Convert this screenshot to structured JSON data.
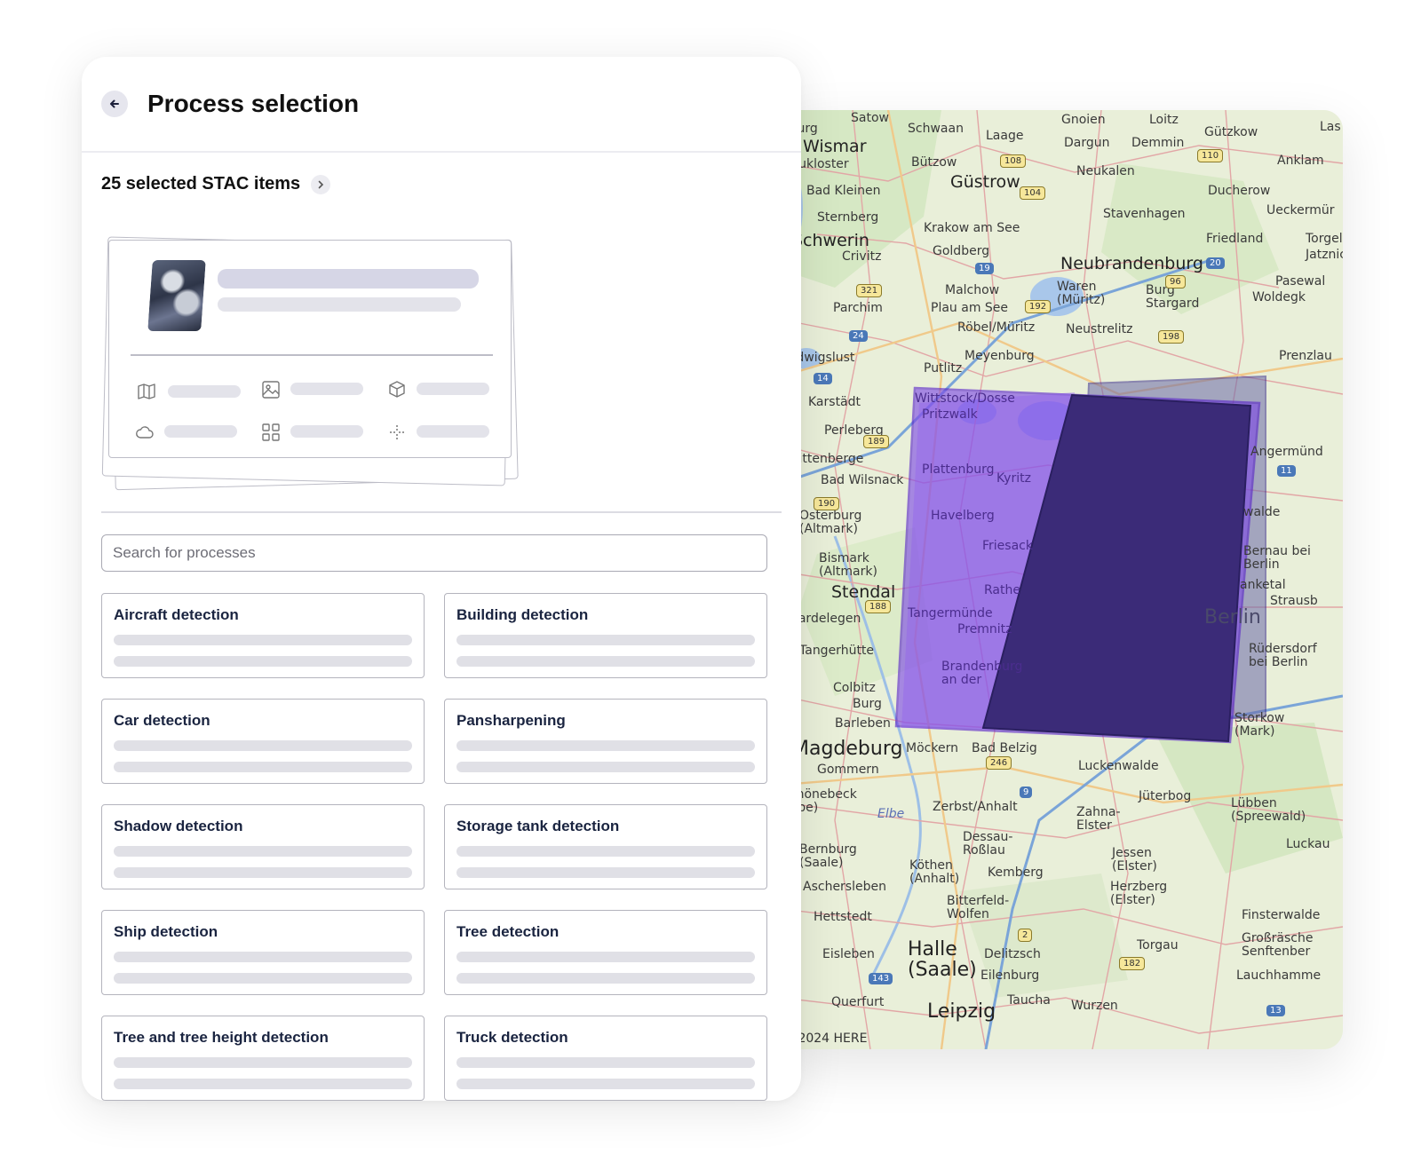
{
  "header": {
    "title": "Process selection"
  },
  "stac": {
    "label": "25 selected STAC items"
  },
  "search": {
    "placeholder": "Search for processes"
  },
  "processes": [
    "Aircraft detection",
    "Building detection",
    "Car detection",
    "Pansharpening",
    "Shadow detection",
    "Storage tank detection",
    "Ship detection",
    "Tree detection",
    "Tree and tree height detection",
    "Truck detection"
  ],
  "map": {
    "copyright": "© 2024 HERE",
    "towns": [
      "Satow",
      "eburg",
      "Wismar",
      "Schwaan",
      "Laage",
      "Gnoien",
      "Loitz",
      "Gützkow",
      "Las",
      "Dargun",
      "Demmin",
      "Anklam",
      "Neukloster",
      "Bützow",
      "Neukalen",
      "Güstrow",
      "Ducherow",
      "Bad Kleinen",
      "Ueckermür",
      "Sternberg",
      "Stavenhagen",
      "Schwerin",
      "Krakow am See",
      "Friedland",
      "Torgelo",
      "Goldberg",
      "Jatznick",
      "Crivitz",
      "Neubrandenburg",
      "Pasewal",
      "Malchow",
      "Waren (Müritz)",
      "Woldegk",
      "Parchim",
      "Plau am See",
      "Burg Stargard",
      "Röbel/Müritz",
      "Neustrelitz",
      "Ludwigslust",
      "Meyenburg",
      "Prenzlau",
      "Putlitz",
      "Wittstock/Dosse",
      "Pritzwalk",
      "Karstädt",
      "Perleberg",
      "Wittenberge",
      "Plattenburg",
      "Kyritz",
      "Angermünd",
      "Bad Wilsnack",
      "Havelberg",
      "Osterburg (Altmark)",
      "Friesack",
      "walde",
      "Bismark (Altmark)",
      "Bernau bei Berlin",
      "Stendal",
      "Rathe",
      "anketal",
      "Strausb",
      "Gardelegen",
      "Tangermünde",
      "Premnitz",
      "Tangerhütte",
      "Rüdersdorf bei Berlin",
      "Brandenburg an der",
      "Colbitz",
      "Burg",
      "Barleben",
      "Storkow (Mark)",
      "Magdeburg",
      "Möckern",
      "Bad Belzig",
      "Gommern",
      "Luckenwalde",
      "Schönebeck (Elbe)",
      "Elbe",
      "Zerbst/Anhalt",
      "Jüterbog",
      "Lübben (Spreewald)",
      "Zahna-Elster",
      "Dessau-Roßlau",
      "Bernburg (Saale)",
      "Köthen (Anhalt)",
      "Kemberg",
      "Jessen (Elster)",
      "Luckau",
      "Aschersleben",
      "Herzberg (Elster)",
      "Bitterfeld-Wolfen",
      "Hettstedt",
      "Finsterwalde",
      "Halle (Saale)",
      "Eisleben",
      "Delitzsch",
      "Torgau",
      "Großräsche Senftenber",
      "Eilenburg",
      "Lauchhamme",
      "Querfurt",
      "Leipzig",
      "Taucha",
      "Wurzen",
      "Berlin"
    ]
  }
}
